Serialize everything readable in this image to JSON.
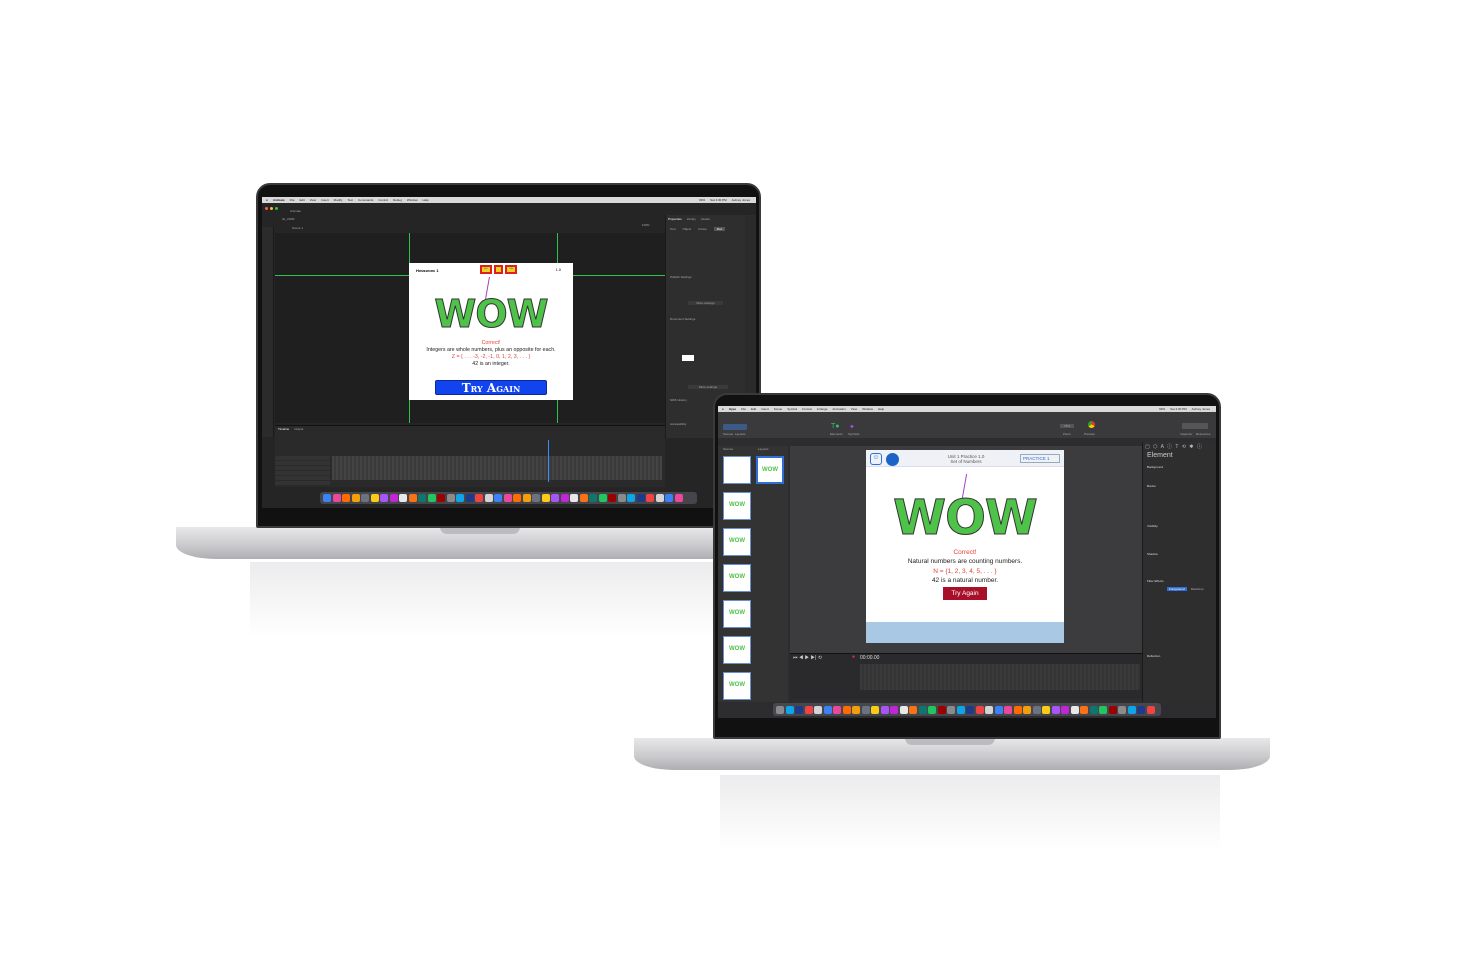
{
  "left_laptop": {
    "menubar": {
      "items": [
        "Animate",
        "File",
        "Edit",
        "View",
        "Insert",
        "Modify",
        "Text",
        "Commands",
        "Control",
        "Debug",
        "Window",
        "Help"
      ],
      "battery": "99%",
      "clock": "Sat 4:30 PM",
      "user": "Aubrey Jones"
    },
    "app_home_tab": "Animate",
    "file_tab": "IG_ANIM",
    "scene": "Scene 1",
    "zoom": "100%",
    "properties": {
      "tabs": [
        "Properties",
        "Library",
        "Assets"
      ],
      "subtabs": [
        "Tool",
        "Object",
        "Frame",
        "Doc"
      ],
      "active_subtab": "Doc",
      "sections": [
        "Publish Settings",
        "Document Settings",
        "SWF History",
        "Accessibility"
      ],
      "buttons": [
        "More settings",
        "More settings"
      ]
    },
    "timeline_tabs": [
      "Timeline",
      "Output"
    ],
    "stage": {
      "title": "Homework 1",
      "version": "1.0",
      "wow": "WOW",
      "correct": "Correct!",
      "explanation": "Integers are whole numbers, plus an opposite for each.",
      "set": "Z = { . . . -3, -2, -1, 0, 1, 2, 3, . . . }",
      "example": "42 is an integer.",
      "button": "Try Again",
      "button_color": "#1144ee"
    }
  },
  "right_laptop": {
    "menubar": {
      "items": [
        "Hype",
        "File",
        "Edit",
        "Insert",
        "Scene",
        "Symbol",
        "Format",
        "Arrange",
        "Animation",
        "View",
        "Window",
        "Help"
      ],
      "battery": "99%",
      "clock": "Sat 4:30 PM",
      "user": "Aubrey Jones"
    },
    "toolbar": {
      "left_labels": [
        "Scenes",
        "Layouts"
      ],
      "center_labels": [
        "Elements",
        "Symbols"
      ],
      "right_labels": [
        "Zoom",
        "Preview",
        "Inspector",
        "Resources"
      ],
      "zoom": "75%"
    },
    "scene_tabs": [
      "Scenes",
      "Layouts"
    ],
    "inspector": {
      "title": "Element",
      "sections": [
        "Background",
        "Border",
        "Visibility",
        "Shadow",
        "Filter Effects",
        "Reflection"
      ],
      "filter_tabs": [
        "Foreground",
        "Backdrop"
      ]
    },
    "timecode": "00:00.00",
    "stage": {
      "header_line1": "Unit 1 Practice 1.0",
      "header_line2": "Set of Numbers",
      "badge": "PRACTICE 1",
      "wow": "WOW",
      "correct": "Correct!",
      "explanation": "Natural numbers are counting numbers.",
      "set": "N = {1, 2, 3, 4, 5, . . . }",
      "example": "42 is a natural number.",
      "button": "Try Again",
      "button_color": "#a8102a"
    }
  },
  "colors": {
    "correct_red": "#e5403a",
    "wow_green": "#4fc24a",
    "accent_blue": "#2f6fd6"
  }
}
